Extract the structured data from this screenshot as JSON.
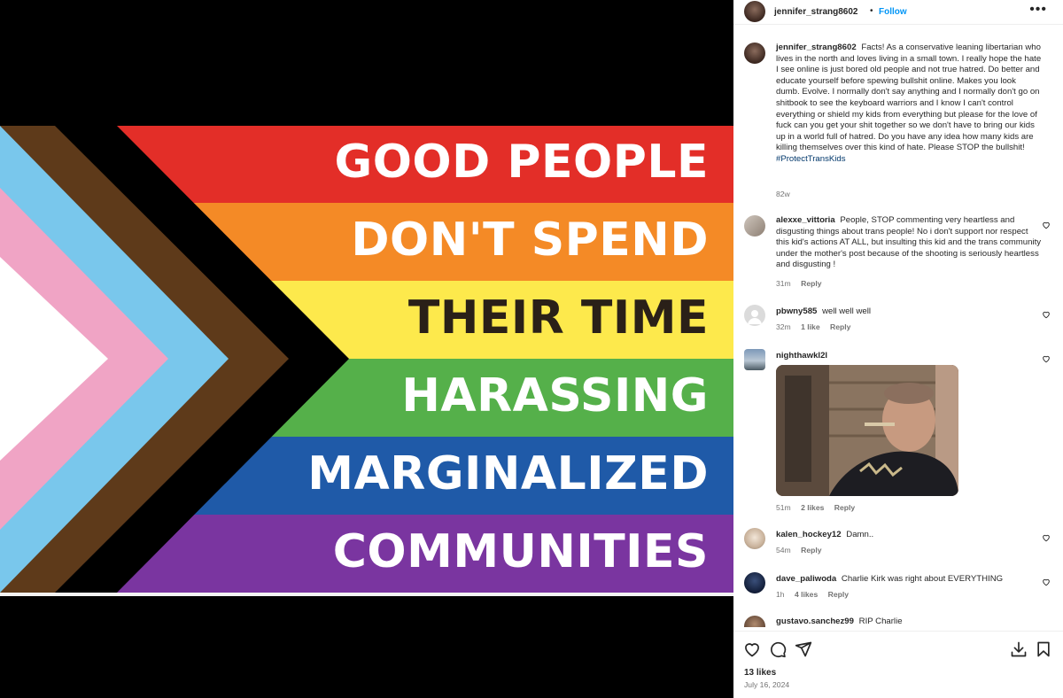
{
  "poster": {
    "username": "jennifer_strang8602",
    "separator": "•",
    "follow_label": "Follow",
    "more_icon": "more-horizontal-icon"
  },
  "flag_image": {
    "lines": [
      "GOOD PEOPLE",
      "DON'T SPEND",
      "THEIR TIME",
      "HARASSING",
      "MARGINALIZED",
      "COMMUNITIES"
    ],
    "stripe_colors": [
      "#e32e28",
      "#f48a26",
      "#fde94c",
      "#55b04a",
      "#1f5aa8",
      "#7a35a0"
    ],
    "chevron_colors": [
      "#000000",
      "#5e3a1a",
      "#79c7ec",
      "#f0a4c5",
      "#ffffff"
    ],
    "text_colors": [
      "#ffffff",
      "#ffffff",
      "#2a2018",
      "#ffffff",
      "#ffffff",
      "#ffffff"
    ]
  },
  "caption": {
    "username": "jennifer_strang8602",
    "text": "Facts! As a conservative leaning libertarian who lives in the north and loves living in a small town. I really hope the hate I see online is just bored old people and not true hatred. Do better and educate yourself before spewing bullshit online. Makes you look dumb. Evolve. I normally don't say anything and I normally don't go on shitbook to see the keyboard warriors and I know I can't control everything or shield my kids from everything but please for the love of fuck can you get your shit together so we don't have to bring our kids up in a world full of hatred. Do you have any idea how many kids are killing themselves over this kind of hate. Please STOP the bullshit!",
    "hashtag": "#ProtectTransKids",
    "time": "82w"
  },
  "comments": [
    {
      "username": "alexxe_vittoria",
      "text": "People, STOP commenting very heartless and disgusting things about trans people! No i don't support nor respect this kid's actions AT ALL, but insulting this kid and the trans community under the mother's post because of the shooting is seriously heartless and disgusting !",
      "time": "31m",
      "likes": "",
      "reply": "Reply"
    },
    {
      "username": "pbwny585",
      "text": "well well well",
      "time": "32m",
      "likes": "1 like",
      "reply": "Reply"
    },
    {
      "username": "nighthawkl2l",
      "text": "",
      "time": "51m",
      "likes": "2 likes",
      "reply": "Reply"
    },
    {
      "username": "kalen_hockey12",
      "text": "Damn..",
      "time": "54m",
      "likes": "",
      "reply": "Reply"
    },
    {
      "username": "dave_paliwoda",
      "text": "Charlie Kirk was right about EVERYTHING",
      "time": "1h",
      "likes": "4 likes",
      "reply": "Reply"
    },
    {
      "username": "gustavo.sanchez99",
      "text": "RIP Charlie",
      "time": "",
      "likes": "",
      "reply": ""
    }
  ],
  "actions": {
    "like_icon": "heart-icon",
    "comment_icon": "comment-icon",
    "share_icon": "send-icon",
    "download_icon": "download-icon",
    "save_icon": "bookmark-icon",
    "likes_label": "13 likes",
    "date": "July 16, 2024"
  },
  "colors": {
    "link_blue": "#0095f6",
    "hashtag": "#00376b",
    "muted": "#737373"
  }
}
